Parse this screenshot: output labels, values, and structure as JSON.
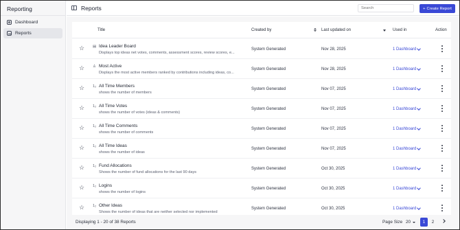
{
  "sidebar": {
    "title": "Reporting",
    "items": [
      {
        "label": "Dashboard",
        "icon": "dashboard-icon",
        "active": false
      },
      {
        "label": "Reports",
        "icon": "reports-icon",
        "active": true
      }
    ]
  },
  "header": {
    "title": "Reports",
    "search_placeholder": "Search",
    "create_label": "Create Report"
  },
  "table": {
    "columns": {
      "title": "Title",
      "created_by": "Created by",
      "last_updated": "Last updated on",
      "used_in": "Used in",
      "action": "Action"
    },
    "rows": [
      {
        "icon": "▤",
        "title": "Idea Leader Board",
        "desc": "Displays top ideas net votes, comments, assessment scores, review scores, e...",
        "created_by": "System Generated",
        "updated": "Nov 28, 2025",
        "used_in": "1 Dashboard"
      },
      {
        "icon": "♙",
        "title": "Most Active",
        "desc": "Displays the most active members ranked by contributions including ideas, co...",
        "created_by": "System Generated",
        "updated": "Nov 28, 2025",
        "used_in": "1 Dashboard"
      },
      {
        "icon": "1₂",
        "title": "All Time Members",
        "desc": "shows the number of members",
        "created_by": "System Generated",
        "updated": "Nov 07, 2025",
        "used_in": "1 Dashboard"
      },
      {
        "icon": "1₂",
        "title": "All Time Votes",
        "desc": "shows the number of votes (ideas & comments)",
        "created_by": "System Generated",
        "updated": "Nov 07, 2025",
        "used_in": "1 Dashboard"
      },
      {
        "icon": "1₂",
        "title": "All Time Comments",
        "desc": "shows the number of comments",
        "created_by": "System Generated",
        "updated": "Nov 07, 2025",
        "used_in": "1 Dashboard"
      },
      {
        "icon": "1₂",
        "title": "All Time Ideas",
        "desc": "shows the number of ideas",
        "created_by": "System Generated",
        "updated": "Nov 07, 2025",
        "used_in": "1 Dashboard"
      },
      {
        "icon": "1₂",
        "title": "Fund Allocations",
        "desc": "Shows the number of fund allocations for the last 90 days",
        "created_by": "System Generated",
        "updated": "Oct 30, 2025",
        "used_in": "1 Dashboard"
      },
      {
        "icon": "1₂",
        "title": "Logins",
        "desc": "shows the number of logins",
        "created_by": "System Generated",
        "updated": "Oct 30, 2025",
        "used_in": "1 Dashboard"
      },
      {
        "icon": "1₂",
        "title": "Other Ideas",
        "desc": "Shows the number of ideas that are neither selected nor implemented",
        "created_by": "System Generated",
        "updated": "Oct 30, 2025",
        "used_in": "1 Dashboard"
      }
    ]
  },
  "footer": {
    "display_text": "Displaying 1 - 20 of 38 Reports",
    "page_size_label": "Page Size",
    "page_size_value": "20",
    "pages": [
      "1",
      "2"
    ],
    "current_page": "1"
  },
  "colors": {
    "accent": "#3a49d6",
    "sidebar_bg": "#f6f6f7",
    "active_nav_bg": "#e5e6ea"
  }
}
